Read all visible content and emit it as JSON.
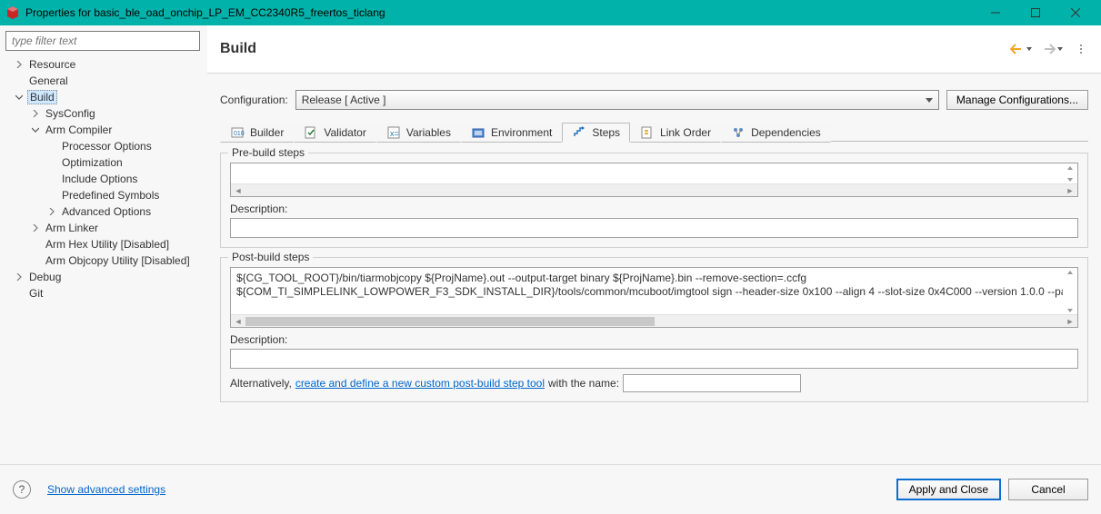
{
  "titlebar": {
    "title": "Properties for basic_ble_oad_onchip_LP_EM_CC2340R5_freertos_ticlang"
  },
  "sidebar": {
    "filter_placeholder": "type filter text",
    "tree": {
      "resource": "Resource",
      "general": "General",
      "build": "Build",
      "sysconfig": "SysConfig",
      "arm_compiler": "Arm Compiler",
      "processor_options": "Processor Options",
      "optimization": "Optimization",
      "include_options": "Include Options",
      "predefined_symbols": "Predefined Symbols",
      "advanced_options": "Advanced Options",
      "arm_linker": "Arm Linker",
      "arm_hex": "Arm Hex Utility  [Disabled]",
      "arm_objcopy": "Arm Objcopy Utility  [Disabled]",
      "debug": "Debug",
      "git": "Git"
    }
  },
  "header": {
    "title": "Build"
  },
  "config": {
    "label": "Configuration:",
    "value": "Release  [ Active ]",
    "manage_btn": "Manage Configurations..."
  },
  "tabs": {
    "builder": "Builder",
    "validator": "Validator",
    "variables": "Variables",
    "environment": "Environment",
    "steps": "Steps",
    "link_order": "Link Order",
    "dependencies": "Dependencies"
  },
  "steps": {
    "pre_group": "Pre-build steps",
    "pre_desc_label": "Description:",
    "post_group": "Post-build steps",
    "post_line1": "${CG_TOOL_ROOT}/bin/tiarmobjcopy ${ProjName}.out --output-target binary ${ProjName}.bin --remove-section=.ccfg",
    "post_line2": "${COM_TI_SIMPLELINK_LOWPOWER_F3_SDK_INSTALL_DIR}/tools/common/mcuboot/imgtool sign --header-size 0x100 --align 4 --slot-size 0x4C000 --version 1.0.0 --pa",
    "post_desc_label": "Description:",
    "alt_prefix": "Alternatively, ",
    "alt_link": "create and define a new custom post-build step tool",
    "alt_suffix": " with the name:"
  },
  "bottom": {
    "advanced": "Show advanced settings",
    "apply": "Apply and Close",
    "cancel": "Cancel"
  }
}
